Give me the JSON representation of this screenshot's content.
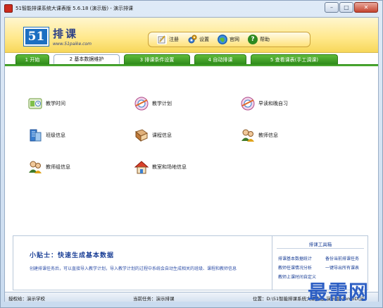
{
  "window": {
    "title": "51智能排课系统大课表版 5.6.18 (演示版) - 演示排课",
    "buttons": [
      "–",
      "□",
      "✕"
    ]
  },
  "banner": {
    "logo_number": "51",
    "logo_text": "排课",
    "logo_url": "www.51paike.com"
  },
  "toolbar": {
    "items": [
      {
        "label": "注册",
        "icon": "register-icon"
      },
      {
        "label": "设置",
        "icon": "settings-icon"
      },
      {
        "label": "官网",
        "icon": "website-icon"
      },
      {
        "label": "帮助",
        "icon": "help-icon"
      }
    ]
  },
  "tabs": [
    {
      "label": "1 开始",
      "active": false
    },
    {
      "label": "2 基本数据维护",
      "active": true
    },
    {
      "label": "3 排课条件设置",
      "active": false
    },
    {
      "label": "4 自动排课",
      "active": false
    },
    {
      "label": "5 查看课表(手工调课)",
      "active": false
    }
  ],
  "panel": {
    "items": [
      {
        "label": "教学时间",
        "icon": "teaching-time-icon"
      },
      {
        "label": "教学计划",
        "icon": "teaching-plan-icon"
      },
      {
        "label": "早读和晚自习",
        "icon": "morning-evening-study-icon"
      },
      {
        "label": "班级信息",
        "icon": "class-info-icon"
      },
      {
        "label": "课程信息",
        "icon": "course-info-icon"
      },
      {
        "label": "教师信息",
        "icon": "teacher-info-icon"
      },
      {
        "label": "教师组信息",
        "icon": "teacher-group-icon"
      },
      {
        "label": "教室和场地信息",
        "icon": "classroom-venue-icon"
      }
    ]
  },
  "tips": {
    "title": "小贴士：快速生成基本数据",
    "body": "创建排课任务后，可以直接导入教学计划，导入教学计划的过程中系统会自动生成相关的班级、课程和教师信息",
    "tools_title": "排课工具箱",
    "tools": [
      "排课基本数据统计",
      "备份当前排课任务",
      "教师任课情况分析",
      "一键导出所有课表",
      "教师上课时间自定义"
    ]
  },
  "status": {
    "school": "授权给：演示学校",
    "task": "当前任务：演示排课",
    "location": "位置：D:\\51智能排课系统大课表版 演示版\\demoD\\演"
  },
  "watermark": "最需网",
  "colors": {
    "tab_green": "#2f8c1b",
    "banner_yellow": "#ffe88a",
    "link_blue": "#1a3f96",
    "logo_blue": "#1c6fc2"
  }
}
